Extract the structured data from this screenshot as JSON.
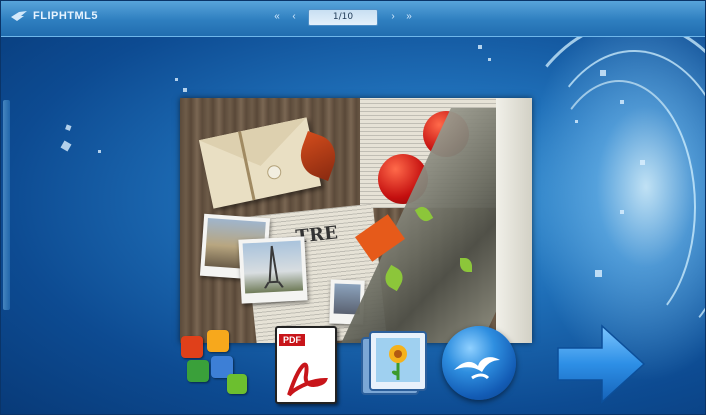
{
  "toolbar": {
    "logo_text": "FLIPHTML5",
    "page_indicator": "1/10",
    "buttons": {
      "first": "first-page",
      "prev": "previous-page",
      "next": "next-page",
      "last": "last-page"
    }
  },
  "book": {
    "page_image": "scrapbook-collage"
  },
  "bottom_icons": [
    {
      "icon": "ms-office-icon"
    },
    {
      "icon": "pdf-icon",
      "tag": "PDF"
    },
    {
      "icon": "image-file-icon"
    },
    {
      "icon": "openoffice-icon"
    },
    {
      "icon": "next-arrow-icon"
    }
  ],
  "colors": {
    "background": "#1f6fb8",
    "toolbar": "#2f7fc0",
    "pdf_red": "#c8151a",
    "arrow_blue": "#2d8fe6"
  }
}
